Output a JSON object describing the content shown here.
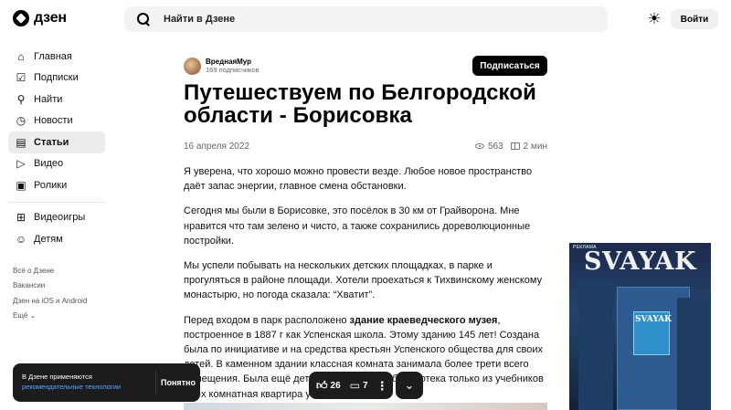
{
  "header": {
    "logo_text": "дзен",
    "search_placeholder": "Найти в Дзене",
    "login_label": "Войти"
  },
  "sidebar": {
    "items": [
      {
        "label": "Главная",
        "icon": "home-icon"
      },
      {
        "label": "Подписки",
        "icon": "check-square-icon"
      },
      {
        "label": "Найти",
        "icon": "search-icon"
      },
      {
        "label": "Новости",
        "icon": "clock-icon"
      },
      {
        "label": "Статьи",
        "icon": "book-icon",
        "active": true
      },
      {
        "label": "Видео",
        "icon": "play-icon"
      },
      {
        "label": "Ролики",
        "icon": "shorts-icon"
      }
    ],
    "extra_items": [
      {
        "label": "Видеоигры",
        "icon": "gamepad-icon"
      },
      {
        "label": "Детям",
        "icon": "kids-icon"
      }
    ],
    "footer_links": [
      "Всё о Дзене",
      "Вакансии",
      "Дзен на iOS и Android",
      "Ещё"
    ]
  },
  "article": {
    "author_name": "ВреднаяМур",
    "author_subscribers": "169 подписчиков",
    "subscribe_label": "Подписаться",
    "title": "Путешествуем по Белгородской области - Борисовка",
    "date": "16 апреля 2022",
    "views": "563",
    "read_time": "2 мин",
    "paragraphs": [
      "Я уверена, что хорошо можно провести везде. Любое новое пространство даёт запас энергии, главное смена обстановки.",
      "Сегодня мы были в Борисовке, это посёлок в 30 км от Грайворона. Мне нравится что там зелено и чисто, а также сохранились дореволюционные постройки.",
      "Мы успели побывать на нескольких детских площадках, в парке и прогуляться в районе площади. Хотели проехаться к Тихвинскому женскому монастырю, но погода сказала: “Хватит”."
    ],
    "p4_before": "Перед входом в парк расположено ",
    "p4_bold": "здание краеведческого музея",
    "p4_after": ", построенное в 1887 г как Успенская школа. Этому зданию 145 лет! Создана была по инициативе и на средства крестьян Успенского общества для своих детей. В каменном здании классная комната занимала более трети всего помещения. Была ещё детская раздевалка, библиотека только из учебников и 2-х комнатная квартира учителя."
  },
  "ad": {
    "label": "РЕКЛАМА",
    "brand": "SVAYAK",
    "panel_text": "SVAYAK"
  },
  "cookie": {
    "text": "В Дзене применяются",
    "link": "рекомендательные технологии",
    "button": "Понятно"
  },
  "actions": {
    "likes": "26",
    "comments": "7"
  },
  "colors": {
    "accent_dark": "#1c1c1e",
    "link_blue": "#5aa7ff",
    "search_bg": "#f2f3f5"
  }
}
